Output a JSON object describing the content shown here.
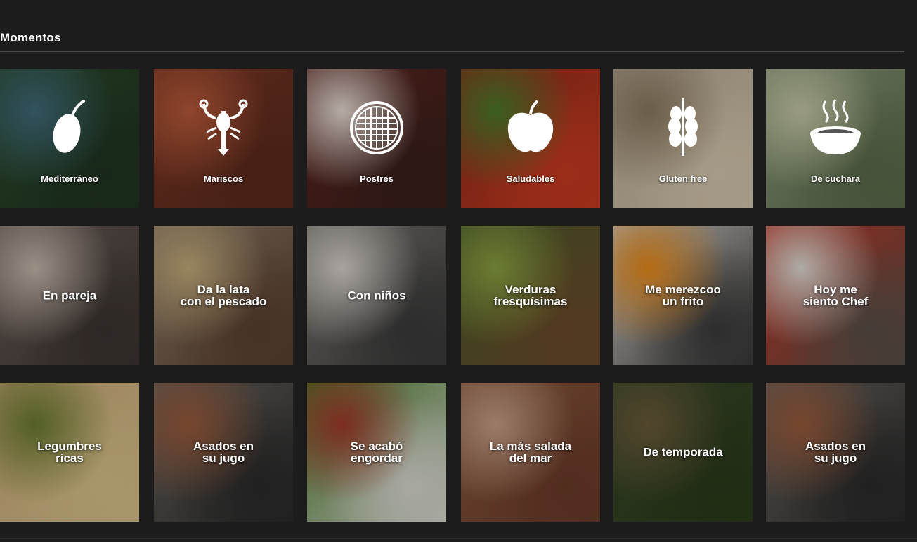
{
  "section": {
    "title": "Momentos"
  },
  "tiles": [
    {
      "name": "tile-mediterraneo",
      "label": [
        "Mediterráneo"
      ],
      "icon": "olive-icon",
      "colors": [
        "#2c4a2a",
        "#3f6a7a",
        "#1f3320"
      ]
    },
    {
      "name": "tile-mariscos",
      "label": [
        "Mariscos"
      ],
      "icon": "lobster-icon",
      "colors": [
        "#7a3524",
        "#b85a3a",
        "#5a2a1c"
      ]
    },
    {
      "name": "tile-postres",
      "label": [
        "Postres"
      ],
      "icon": "pie-icon",
      "colors": [
        "#5b2420",
        "#e8ddd5",
        "#3a1f1a"
      ]
    },
    {
      "name": "tile-saludables",
      "label": [
        "Saludables"
      ],
      "icon": "apple-icon",
      "colors": [
        "#8a2a1a",
        "#4c7a2a",
        "#c83a20"
      ]
    },
    {
      "name": "tile-gluten-free",
      "label": [
        "Gluten free"
      ],
      "icon": "wheat-icon",
      "colors": [
        "#b4a590",
        "#8a7960",
        "#d4c6ad"
      ]
    },
    {
      "name": "tile-de-cuchara",
      "label": [
        "De cuchara"
      ],
      "icon": "soup-bowl-icon",
      "colors": [
        "#8a9a7a",
        "#c5c8a6",
        "#5a6a4a"
      ]
    },
    {
      "name": "tile-en-pareja",
      "label": [
        "En pareja"
      ],
      "icon": "",
      "colors": [
        "#6b5e58",
        "#c6b8ac",
        "#3b3430"
      ]
    },
    {
      "name": "tile-da-la-lata",
      "label": [
        "Da la lata",
        "con el pescado"
      ],
      "icon": "",
      "colors": [
        "#8a7a68",
        "#c4aa7a",
        "#5a4030"
      ]
    },
    {
      "name": "tile-con-ninos",
      "label": [
        "Con niños"
      ],
      "icon": "",
      "colors": [
        "#7a7670",
        "#d8d2cc",
        "#3a3a3a"
      ]
    },
    {
      "name": "tile-verduras",
      "label": [
        "Verduras",
        "fresquísimas"
      ],
      "icon": "",
      "colors": [
        "#4a5a2a",
        "#8aa040",
        "#6a4a2a"
      ]
    },
    {
      "name": "tile-me-merezco",
      "label": [
        "Me merezcoo",
        "un frito"
      ],
      "icon": "",
      "colors": [
        "#d8d4cc",
        "#e88a1a",
        "#3a3a3a"
      ]
    },
    {
      "name": "tile-hoy-me-siento-chef",
      "label": [
        "Hoy me",
        "siento Chef"
      ],
      "icon": "",
      "colors": [
        "#c03020",
        "#e0dcd4",
        "#5a5048"
      ]
    },
    {
      "name": "tile-legumbres",
      "label": [
        "Legumbres",
        "ricas"
      ],
      "icon": "",
      "colors": [
        "#c8a878",
        "#6a7a30",
        "#d8c088"
      ]
    },
    {
      "name": "tile-asados-1",
      "label": [
        "Asados en",
        "su jugo"
      ],
      "icon": "",
      "colors": [
        "#6a6660",
        "#9a5a3a",
        "#2a2a2a"
      ]
    },
    {
      "name": "tile-se-acabo-engordar",
      "label": [
        "Se acabó",
        "engordar"
      ],
      "icon": "",
      "colors": [
        "#4a7a2a",
        "#a03a2a",
        "#d8d8d0"
      ]
    },
    {
      "name": "tile-la-mas-salada",
      "label": [
        "La más salada",
        "del mar"
      ],
      "icon": "",
      "colors": [
        "#8a5a40",
        "#c8a088",
        "#6a3a28"
      ]
    },
    {
      "name": "tile-de-temporada",
      "label": [
        "De temporada"
      ],
      "icon": "",
      "colors": [
        "#3a4a2a",
        "#6a5a3a",
        "#2a3a1a"
      ]
    },
    {
      "name": "tile-asados-2",
      "label": [
        "Asados en",
        "su jugo"
      ],
      "icon": "",
      "colors": [
        "#6a6660",
        "#9a5a3a",
        "#2a2a2a"
      ]
    }
  ]
}
